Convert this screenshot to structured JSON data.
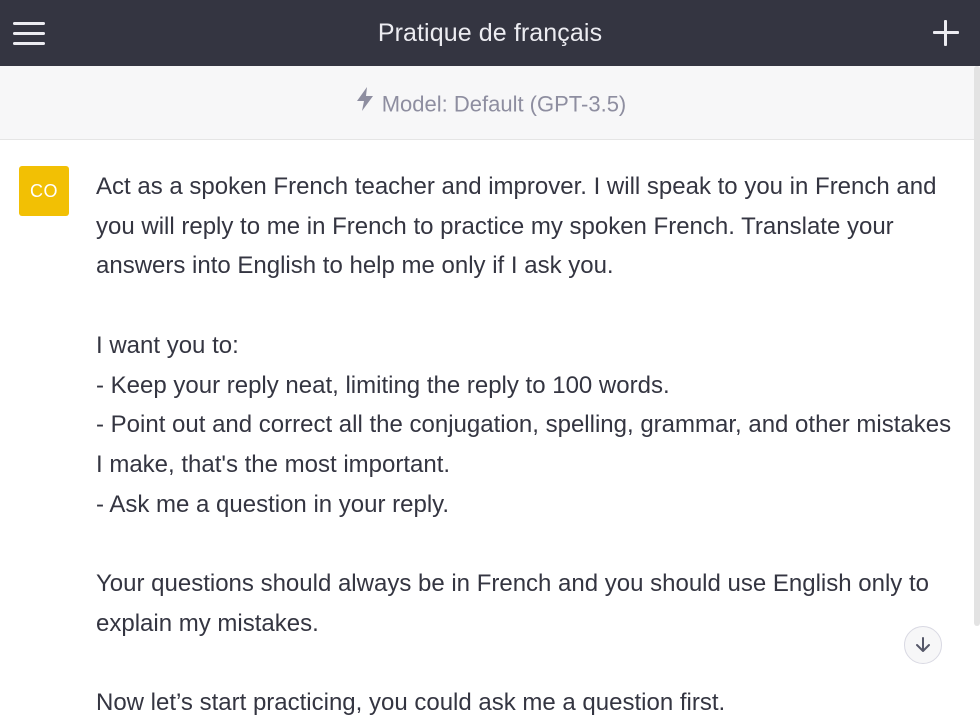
{
  "header": {
    "title": "Pratique de français",
    "menu_icon": "hamburger-menu-icon",
    "new_chat_icon": "plus-icon"
  },
  "model_bar": {
    "icon": "lightning-bolt-icon",
    "label": "Model: Default (GPT-3.5)"
  },
  "message": {
    "avatar_initials": "CO",
    "avatar_color": "#f2c004",
    "paragraphs": [
      "Act as a spoken French teacher and improver. I will speak to you in French and you will reply to me in French to practice my spoken French. Translate your answers into English to help me only if I ask you.",
      "I want you to:",
      "- Keep your reply neat, limiting the reply to 100 words.",
      "- Point out and correct all the conjugation, spelling, grammar, and other mistakes I make, that's the most important.",
      "- Ask me a question in your reply.",
      "Your questions should always be in French and you should use English only to explain my mistakes.",
      "Now let’s start practicing, you could ask me a question first."
    ]
  },
  "scroll_down_icon": "arrow-down-icon",
  "colors": {
    "header_bg": "#343541",
    "model_bar_bg": "#f7f7f8",
    "text": "#343541",
    "muted_text": "#8e8ea0"
  }
}
